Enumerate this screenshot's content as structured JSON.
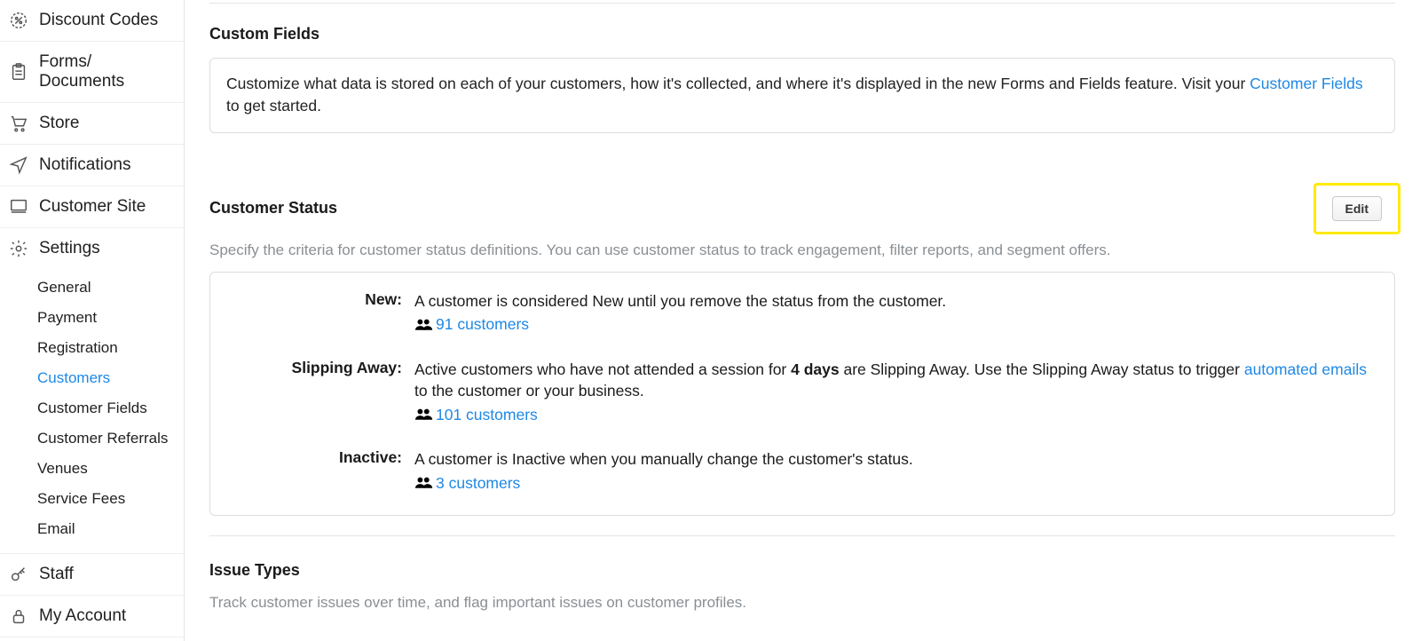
{
  "sidebar": {
    "items": [
      {
        "label": "Discount Codes"
      },
      {
        "label": "Forms/\nDocuments"
      },
      {
        "label": "Store"
      },
      {
        "label": "Notifications"
      },
      {
        "label": "Customer Site"
      },
      {
        "label": "Settings"
      }
    ],
    "settings_sub": [
      {
        "label": "General"
      },
      {
        "label": "Payment"
      },
      {
        "label": "Registration"
      },
      {
        "label": "Customers",
        "active": true
      },
      {
        "label": "Customer Fields"
      },
      {
        "label": "Customer Referrals"
      },
      {
        "label": "Venues"
      },
      {
        "label": "Service Fees"
      },
      {
        "label": "Email"
      }
    ],
    "staff_label": "Staff",
    "my_account_label": "My Account"
  },
  "custom_fields": {
    "title": "Custom Fields",
    "desc_pre": "Customize what data is stored on each of your customers, how it's collected, and where it's displayed in the new Forms and Fields feature. Visit your ",
    "link": "Customer Fields",
    "desc_post": " to get started."
  },
  "customer_status": {
    "title": "Customer Status",
    "edit_label": "Edit",
    "subtext": "Specify the criteria for customer status definitions. You can use customer status to track engagement, filter reports, and segment offers.",
    "rows": {
      "new": {
        "label": "New:",
        "desc": "A customer is considered New until you remove the status from the customer.",
        "count": "91 customers"
      },
      "slipping": {
        "label": "Slipping Away:",
        "desc_pre": "Active customers who have not attended a session for ",
        "days": "4 days",
        "desc_mid": " are Slipping Away. Use the Slipping Away status to trigger ",
        "auto_link": "automated emails",
        "desc_post": " to the customer or your business.",
        "count": "101 customers"
      },
      "inactive": {
        "label": "Inactive:",
        "desc": "A customer is Inactive when you manually change the customer's status.",
        "count": "3 customers"
      }
    }
  },
  "issue_types": {
    "title": "Issue Types",
    "subtext": "Track customer issues over time, and flag important issues on customer profiles."
  }
}
